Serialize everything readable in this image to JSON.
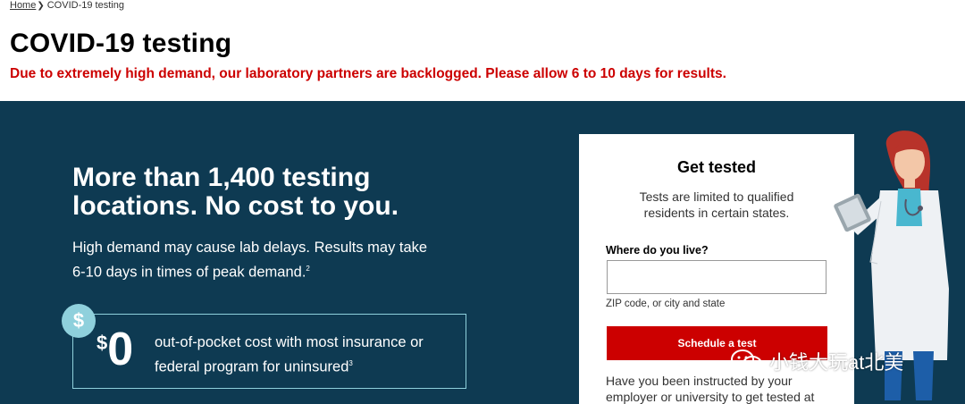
{
  "breadcrumb": {
    "home": "Home",
    "current": "COVID-19 testing"
  },
  "page": {
    "title": "COVID-19 testing",
    "alert": "Due to extremely high demand, our laboratory partners are backlogged. Please allow 6 to 10 days for results."
  },
  "hero": {
    "heading": "More than 1,400 testing locations. No cost to you.",
    "sub": "High demand may cause lab delays. Results may take 6-10 days in times of peak demand.",
    "sub_footnote": "2",
    "badge_symbol": "$",
    "cost_currency": "$",
    "cost_amount": "0",
    "cost_text": "out-of-pocket cost with most insurance or federal program for uninsured",
    "cost_footnote": "3"
  },
  "card": {
    "title": "Get tested",
    "description": "Tests are limited to qualified residents in certain states.",
    "field_label": "Where do you live?",
    "field_value": "",
    "field_hint": "ZIP code, or city and state",
    "button_label": "Schedule a test",
    "footer": "Have you been instructed by your employer or university to get tested at"
  },
  "watermark": {
    "text": "小钱大玩at北美"
  },
  "colors": {
    "hero_bg": "#0e3a52",
    "alert_red": "#cc0000",
    "accent_teal": "#8fd0dc"
  }
}
